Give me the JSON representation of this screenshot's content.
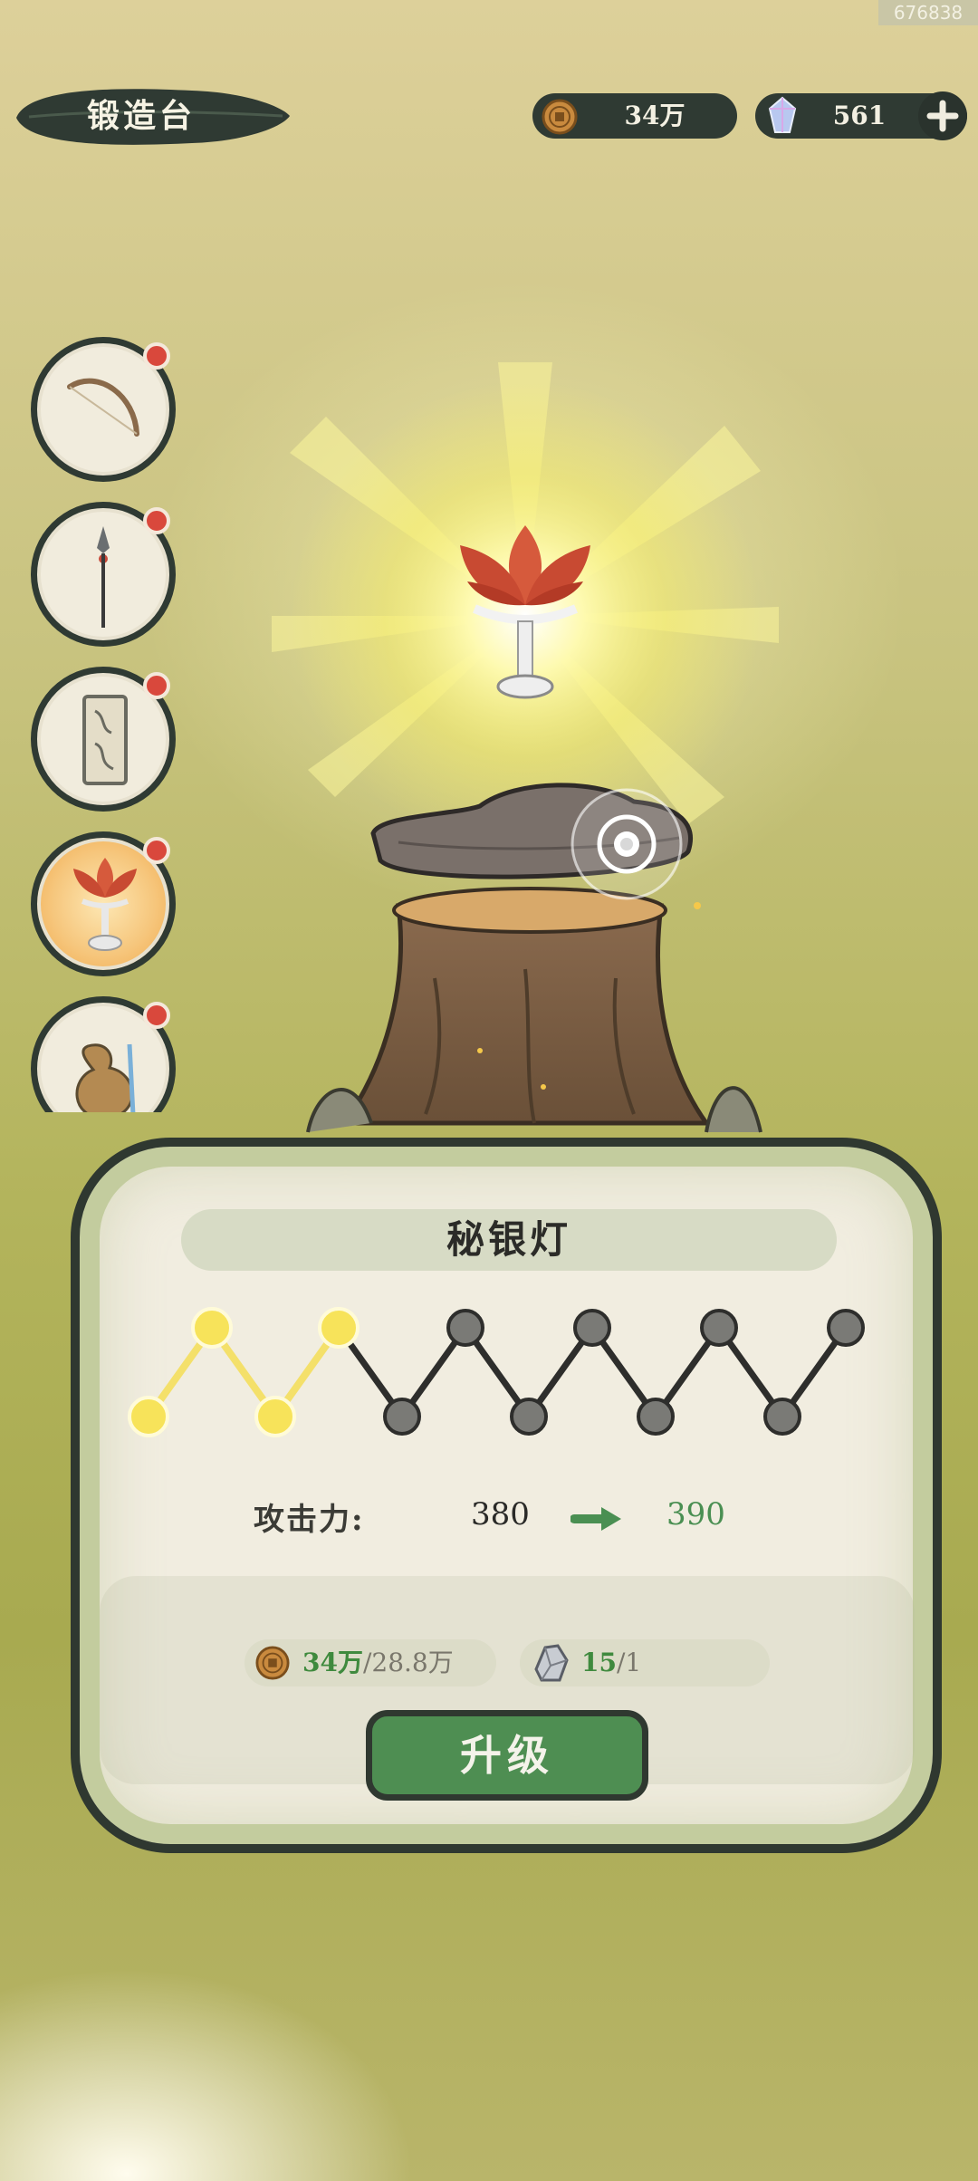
{
  "build_id": "676838",
  "title": "锻造台",
  "resources": {
    "coins": "34万",
    "gems": "561"
  },
  "side_items": [
    {
      "name": "bow",
      "active": false
    },
    {
      "name": "spear",
      "active": false
    },
    {
      "name": "talisman",
      "active": false
    },
    {
      "name": "lotus-lamp",
      "active": true
    },
    {
      "name": "gourd",
      "active": false
    }
  ],
  "item": {
    "name": "秘银灯",
    "levels_total": 12,
    "levels_lit": 4
  },
  "stat": {
    "label": "攻击力:",
    "current": "380",
    "next": "390"
  },
  "cost": {
    "coin_have": "34万",
    "coin_need": "/28.8万",
    "ore_have": "15",
    "ore_need": "/1"
  },
  "upgrade_label": "升级",
  "colors": {
    "dark": "#2f3830",
    "accent_green": "#4e8e52",
    "lit_node": "#f7e35a",
    "notification": "#d9483c"
  }
}
